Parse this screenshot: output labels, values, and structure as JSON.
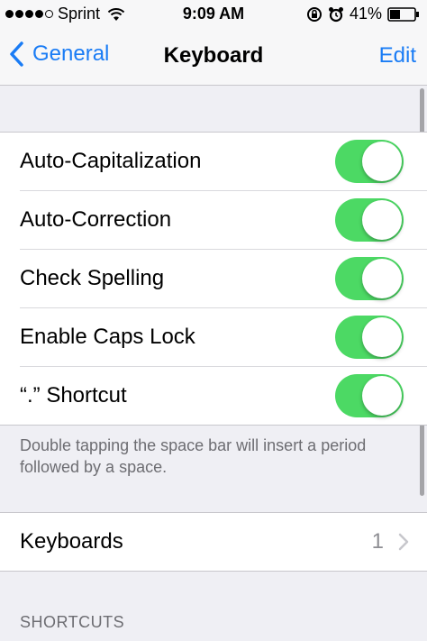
{
  "status_bar": {
    "signal_bars": 5,
    "carrier": "Sprint",
    "time": "9:09 AM",
    "battery_percent": "41%",
    "icons": [
      "wifi-icon",
      "rotation-lock-icon",
      "alarm-icon",
      "battery-icon"
    ]
  },
  "nav": {
    "back_label": "General",
    "title": "Keyboard",
    "edit_label": "Edit"
  },
  "settings": [
    {
      "label": "Auto-Capitalization",
      "on": true
    },
    {
      "label": "Auto-Correction",
      "on": true
    },
    {
      "label": "Check Spelling",
      "on": true
    },
    {
      "label": "Enable Caps Lock",
      "on": true
    },
    {
      "label": "“.” Shortcut",
      "on": true
    }
  ],
  "footer_note": "Double tapping the space bar will insert a period followed by a space.",
  "keyboards_row": {
    "label": "Keyboards",
    "count": "1"
  },
  "shortcuts_header": "SHORTCUTS",
  "colors": {
    "accent": "#1a7cf5",
    "switch_on": "#4cd964",
    "background": "#efeff4"
  }
}
